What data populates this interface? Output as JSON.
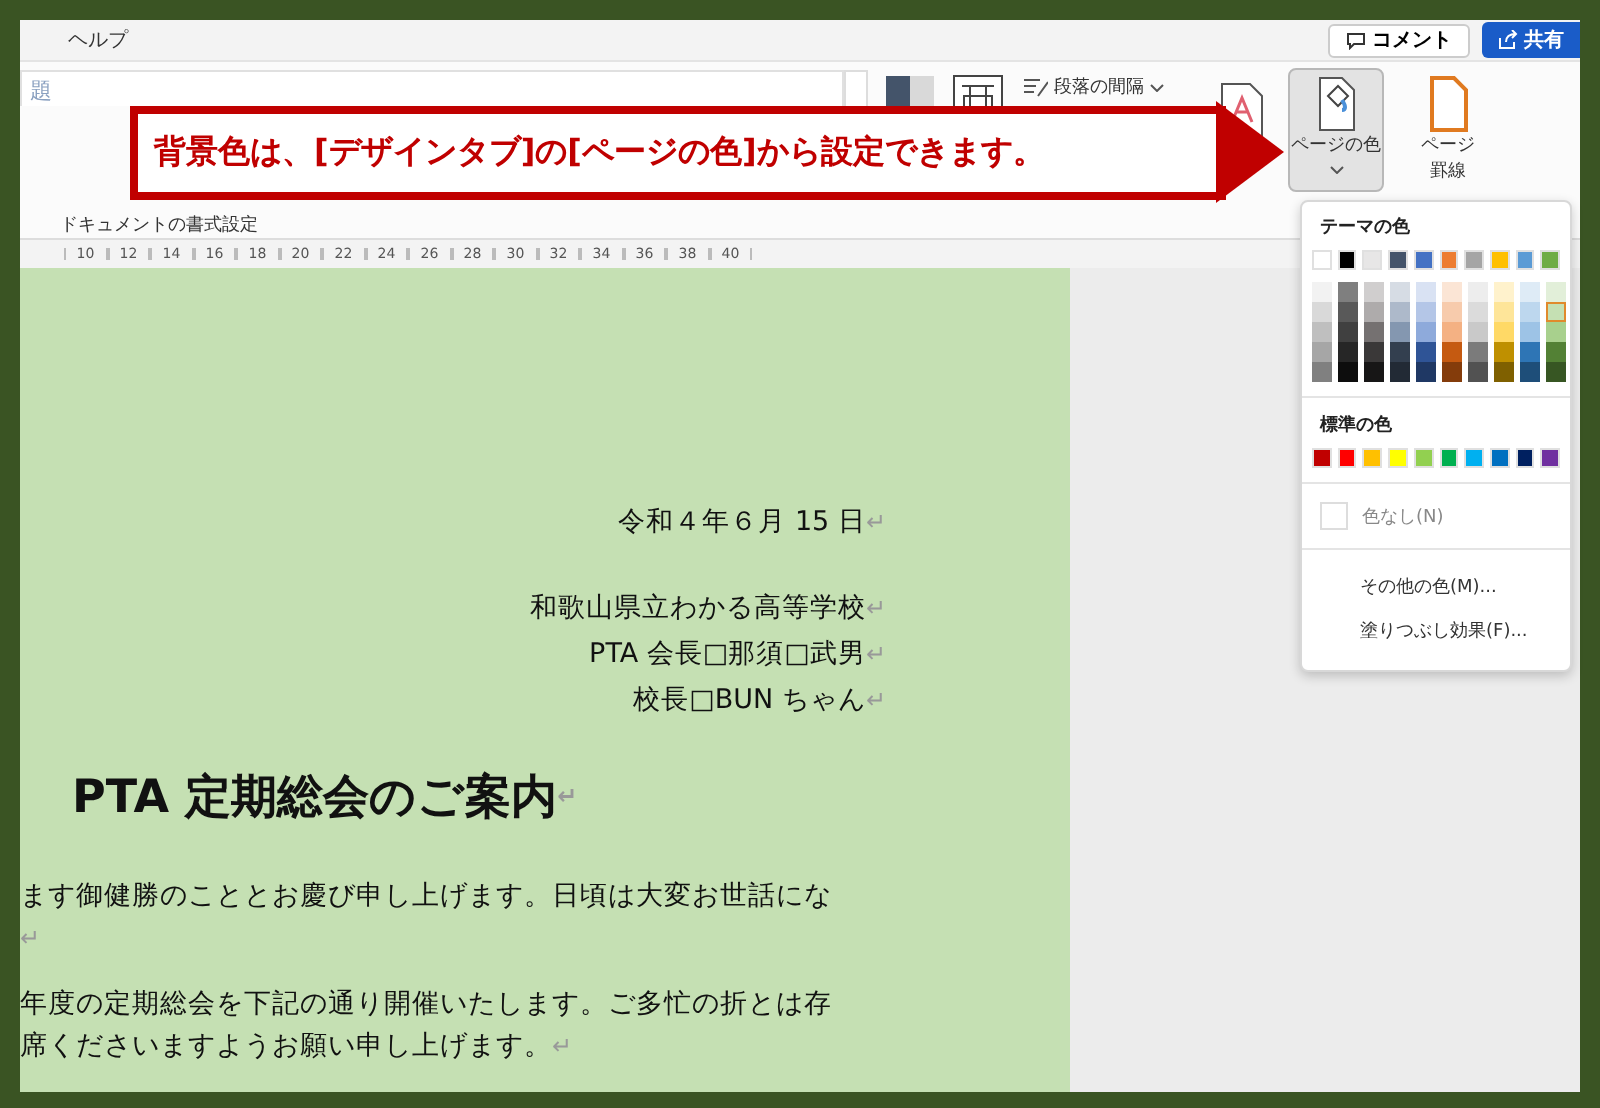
{
  "menu_bar": {
    "items": [
      {
        "label": "ヘルプ"
      }
    ],
    "comment_button": {
      "label": "コメント"
    },
    "share_button": {
      "label": "共有"
    }
  },
  "ribbon": {
    "style_gallery": {
      "items": [
        "題"
      ]
    },
    "buttons": [
      {
        "kind": "theme_colors"
      },
      {
        "kind": "fonts"
      },
      {
        "kind": "spacing",
        "label": "段落の間隔"
      },
      {
        "kind": "watermark"
      },
      {
        "kind": "page_color",
        "label": "ページの色",
        "pressed": true
      },
      {
        "kind": "page_border",
        "label": "ページ",
        "label2": "罫線",
        "pressed": false
      }
    ],
    "group_label": "ドキュメントの書式設定"
  },
  "ruler": {
    "labels": [
      "10",
      "12",
      "14",
      "16",
      "18",
      "20",
      "22",
      "24",
      "26",
      "28",
      "30",
      "32",
      "34",
      "36",
      "38",
      "40"
    ]
  },
  "callout": {
    "text": "背景色は、[デザインタブ]の[ページの色]から設定できます。"
  },
  "page_color_menu": {
    "theme_heading": "テーマの色",
    "theme_colors": [
      {
        "color": "#ffffff",
        "selected": false,
        "shades": [
          {
            "color": "#f2f2f2",
            "selected": false
          },
          {
            "color": "#d9d9d9",
            "selected": false
          },
          {
            "color": "#bfbfbf",
            "selected": false
          },
          {
            "color": "#a6a6a6",
            "selected": false
          },
          {
            "color": "#808080",
            "selected": false
          }
        ]
      },
      {
        "color": "#000000",
        "selected": false,
        "shades": [
          {
            "color": "#7f7f7f",
            "selected": false
          },
          {
            "color": "#595959",
            "selected": false
          },
          {
            "color": "#404040",
            "selected": false
          },
          {
            "color": "#262626",
            "selected": false
          },
          {
            "color": "#0d0d0d",
            "selected": false
          }
        ]
      },
      {
        "color": "#e7e6e6",
        "selected": false,
        "shades": [
          {
            "color": "#d0cece",
            "selected": false
          },
          {
            "color": "#aeabab",
            "selected": false
          },
          {
            "color": "#757171",
            "selected": false
          },
          {
            "color": "#3a3838",
            "selected": false
          },
          {
            "color": "#171616",
            "selected": false
          }
        ]
      },
      {
        "color": "#44546a",
        "selected": false,
        "shades": [
          {
            "color": "#d6dce4",
            "selected": false
          },
          {
            "color": "#adb9ca",
            "selected": false
          },
          {
            "color": "#8497b0",
            "selected": false
          },
          {
            "color": "#333f4f",
            "selected": false
          },
          {
            "color": "#222a35",
            "selected": false
          }
        ]
      },
      {
        "color": "#4472c4",
        "selected": false,
        "shades": [
          {
            "color": "#d9e2f3",
            "selected": false
          },
          {
            "color": "#b4c6e7",
            "selected": false
          },
          {
            "color": "#8eaadb",
            "selected": false
          },
          {
            "color": "#2f5496",
            "selected": false
          },
          {
            "color": "#1f3864",
            "selected": false
          }
        ]
      },
      {
        "color": "#ed7d31",
        "selected": false,
        "shades": [
          {
            "color": "#fbe5d5",
            "selected": false
          },
          {
            "color": "#f7cbac",
            "selected": false
          },
          {
            "color": "#f4b183",
            "selected": false
          },
          {
            "color": "#c55a11",
            "selected": false
          },
          {
            "color": "#843c0b",
            "selected": false
          }
        ]
      },
      {
        "color": "#a5a5a5",
        "selected": false,
        "shades": [
          {
            "color": "#ededed",
            "selected": false
          },
          {
            "color": "#dbdbdb",
            "selected": false
          },
          {
            "color": "#c9c9c9",
            "selected": false
          },
          {
            "color": "#7b7b7b",
            "selected": false
          },
          {
            "color": "#525252",
            "selected": false
          }
        ]
      },
      {
        "color": "#ffc000",
        "selected": false,
        "shades": [
          {
            "color": "#fff2cc",
            "selected": false
          },
          {
            "color": "#fee599",
            "selected": false
          },
          {
            "color": "#ffd966",
            "selected": false
          },
          {
            "color": "#bf9000",
            "selected": false
          },
          {
            "color": "#7f6000",
            "selected": false
          }
        ]
      },
      {
        "color": "#5b9bd5",
        "selected": false,
        "shades": [
          {
            "color": "#deebf6",
            "selected": false
          },
          {
            "color": "#bdd7ee",
            "selected": false
          },
          {
            "color": "#9dc3e6",
            "selected": false
          },
          {
            "color": "#2e75b5",
            "selected": false
          },
          {
            "color": "#1e4e79",
            "selected": false
          }
        ]
      },
      {
        "color": "#70ad47",
        "selected": false,
        "shades": [
          {
            "color": "#e2efd9",
            "selected": false
          },
          {
            "color": "#c5e0b3",
            "selected": true
          },
          {
            "color": "#a8d08d",
            "selected": false
          },
          {
            "color": "#538135",
            "selected": false
          },
          {
            "color": "#375623",
            "selected": false
          }
        ]
      }
    ],
    "standard_heading": "標準の色",
    "standard_colors": [
      {
        "color": "#c00000",
        "selected": false
      },
      {
        "color": "#ff0000",
        "selected": false
      },
      {
        "color": "#ffc000",
        "selected": false
      },
      {
        "color": "#ffff00",
        "selected": false
      },
      {
        "color": "#92d050",
        "selected": false
      },
      {
        "color": "#00b050",
        "selected": false
      },
      {
        "color": "#00b0f0",
        "selected": false
      },
      {
        "color": "#0070c0",
        "selected": false
      },
      {
        "color": "#002060",
        "selected": false
      },
      {
        "color": "#7030a0",
        "selected": false
      }
    ],
    "items": [
      {
        "kind": "no_color",
        "label": "色なし(N)"
      },
      {
        "kind": "command",
        "label": "その他の色(M)..."
      },
      {
        "kind": "command",
        "label": "塗りつぶし効果(F)..."
      }
    ]
  },
  "document": {
    "lines": [
      {
        "kind": "right",
        "text": "令和４年６月 15 日",
        "mark": "↵"
      },
      {
        "kind": "right",
        "text": "和歌山県立わかる高等学校",
        "mark": "↵"
      },
      {
        "kind": "right",
        "text": "PTA 会長□那須□武男",
        "mark": "↵"
      },
      {
        "kind": "right",
        "text": "校長□BUN ちゃん",
        "mark": "↵"
      },
      {
        "kind": "title",
        "text": "PTA 定期総会のご案内",
        "mark": "↵"
      },
      {
        "kind": "body",
        "text": "ます御健勝のこととお慶び申し上げます。日頃は大変お世話にな"
      },
      {
        "kind": "body",
        "mark": "↵"
      },
      {
        "kind": "body",
        "text": "年度の定期総会を下記の通り開催いたします。ご多忙の折とは存"
      },
      {
        "kind": "body",
        "text": "席くださいますようお願い申し上げます。",
        "mark": "↵"
      }
    ]
  }
}
